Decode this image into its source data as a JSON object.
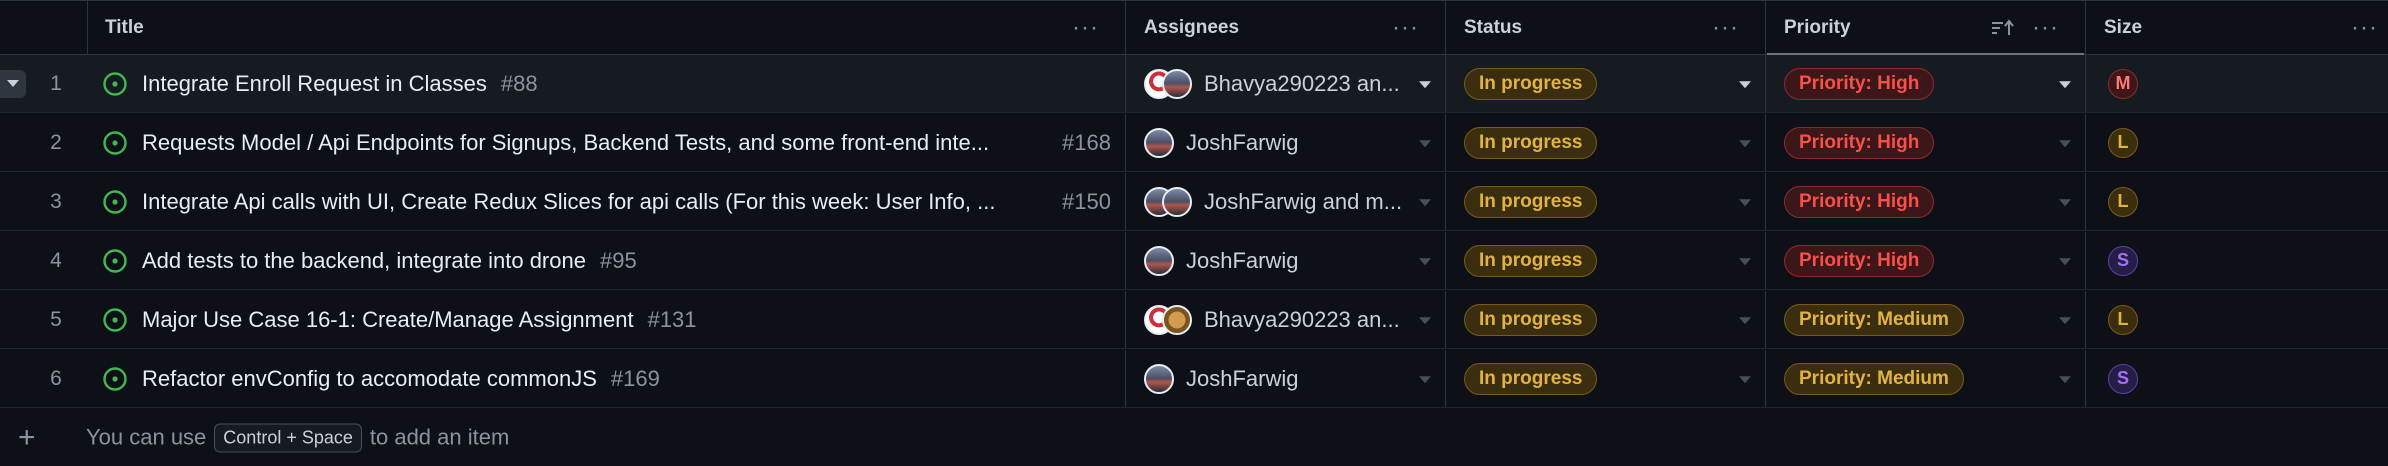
{
  "columns": {
    "title": "Title",
    "assignees": "Assignees",
    "status": "Status",
    "priority": "Priority",
    "size": "Size"
  },
  "rows": [
    {
      "num": "1",
      "title": "Integrate Enroll Request in Classes",
      "issue": "#88",
      "assignees": "Bhavya290223 an...",
      "status": "In progress",
      "priority": "Priority: High",
      "size": "M"
    },
    {
      "num": "2",
      "title": "Requests Model / Api Endpoints for Signups, Backend Tests, and some front-end inte...",
      "issue": "#168",
      "assignees": "JoshFarwig",
      "status": "In progress",
      "priority": "Priority: High",
      "size": "L"
    },
    {
      "num": "3",
      "title": "Integrate Api calls with UI, Create Redux Slices for api calls (For this week: User Info, ...",
      "issue": "#150",
      "assignees": "JoshFarwig and m...",
      "status": "In progress",
      "priority": "Priority: High",
      "size": "L"
    },
    {
      "num": "4",
      "title": "Add tests to the backend, integrate into drone",
      "issue": "#95",
      "assignees": "JoshFarwig",
      "status": "In progress",
      "priority": "Priority: High",
      "size": "S"
    },
    {
      "num": "5",
      "title": "Major Use Case 16-1: Create/Manage Assignment",
      "issue": "#131",
      "assignees": "Bhavya290223 an...",
      "status": "In progress",
      "priority": "Priority: Medium",
      "size": "L"
    },
    {
      "num": "6",
      "title": "Refactor envConfig to accomodate commonJS",
      "issue": "#169",
      "assignees": "JoshFarwig",
      "status": "In progress",
      "priority": "Priority: Medium",
      "size": "S"
    }
  ],
  "footer": {
    "before": "You can use",
    "shortcut": "Control + Space",
    "after": "to add an item"
  },
  "icons": {
    "open_issue": "issue-opened-icon",
    "more": "kebab-horizontal-icon",
    "sort": "sort-ascending-icon",
    "add": "plus-icon"
  },
  "colors": {
    "background": "#0d1117",
    "open_issue": "#3fb950",
    "status": "#e3b341",
    "priority_high": "#f85149",
    "priority_medium": "#e3b341",
    "size_m": "#ff7b72",
    "size_l": "#e3b341",
    "size_s": "#a371f7"
  }
}
